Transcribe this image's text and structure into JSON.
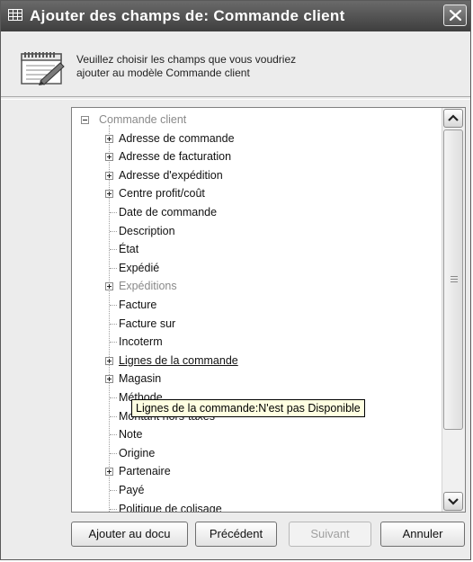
{
  "window": {
    "title": "Ajouter des champs de:  Commande client"
  },
  "header": {
    "line1": "Veuillez choisir les champs que vous voudriez",
    "line2": "ajouter au modèle Commande client"
  },
  "tree": {
    "root": "Commande client",
    "items": [
      {
        "label": "Adresse de commande",
        "expandable": true,
        "disabled": false,
        "underline": false
      },
      {
        "label": "Adresse de facturation",
        "expandable": true,
        "disabled": false,
        "underline": false
      },
      {
        "label": "Adresse d'expédition",
        "expandable": true,
        "disabled": false,
        "underline": false
      },
      {
        "label": "Centre profit/coût",
        "expandable": true,
        "disabled": false,
        "underline": false
      },
      {
        "label": "Date de commande",
        "expandable": false,
        "disabled": false,
        "underline": false
      },
      {
        "label": "Description",
        "expandable": false,
        "disabled": false,
        "underline": false
      },
      {
        "label": "État",
        "expandable": false,
        "disabled": false,
        "underline": false
      },
      {
        "label": "Expédié",
        "expandable": false,
        "disabled": false,
        "underline": false
      },
      {
        "label": "Expéditions",
        "expandable": true,
        "disabled": true,
        "underline": false
      },
      {
        "label": "Facture",
        "expandable": false,
        "disabled": false,
        "underline": false
      },
      {
        "label": "Facture sur",
        "expandable": false,
        "disabled": false,
        "underline": false
      },
      {
        "label": "Incoterm",
        "expandable": false,
        "disabled": false,
        "underline": false
      },
      {
        "label": "Lignes de la commande",
        "expandable": true,
        "disabled": false,
        "underline": true
      },
      {
        "label": "Magasin",
        "expandable": true,
        "disabled": false,
        "underline": false
      },
      {
        "label": "Méthode",
        "expandable": false,
        "disabled": false,
        "underline": false
      },
      {
        "label": "Montant hors-taxes",
        "expandable": false,
        "disabled": false,
        "underline": false
      },
      {
        "label": "Note",
        "expandable": false,
        "disabled": false,
        "underline": false
      },
      {
        "label": "Origine",
        "expandable": false,
        "disabled": false,
        "underline": false
      },
      {
        "label": "Partenaire",
        "expandable": true,
        "disabled": false,
        "underline": false
      },
      {
        "label": "Payé",
        "expandable": false,
        "disabled": false,
        "underline": false
      },
      {
        "label": "Politique de colisage",
        "expandable": false,
        "disabled": false,
        "underline": false
      }
    ]
  },
  "tooltip": {
    "text": "Lignes de la commande:N'est pas Disponible"
  },
  "buttons": {
    "add": "Ajouter au docu",
    "previous": "Précédent",
    "next": "Suivant",
    "cancel": "Annuler"
  },
  "icons": {
    "title": "grid-icon",
    "close": "close-icon",
    "header": "notepad-pencil-icon",
    "scroll_up": "chevron-up-icon",
    "scroll_down": "chevron-down-icon"
  }
}
